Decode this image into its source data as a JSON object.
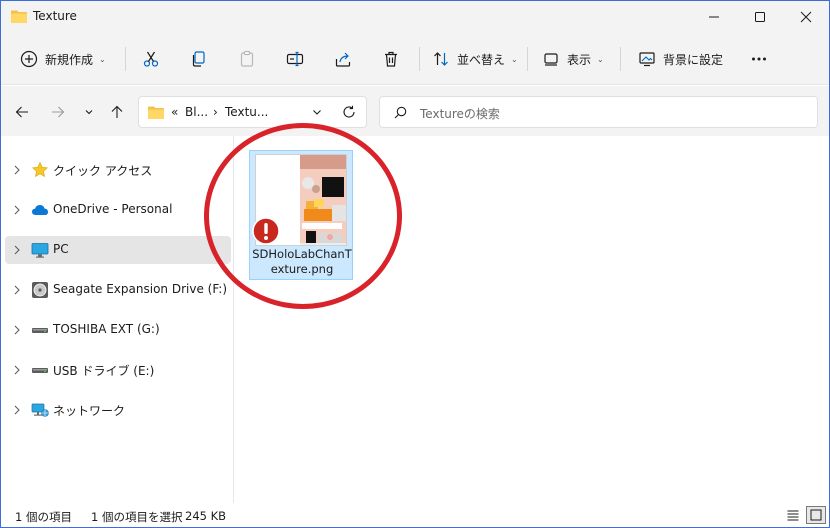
{
  "window": {
    "title": "Texture"
  },
  "toolbar": {
    "new_label": "新規作成",
    "sort_label": "並べ替え",
    "view_label": "表示",
    "set_background_label": "背景に設定"
  },
  "address": {
    "segments": [
      "«",
      "Bl...",
      "›",
      "Textu..."
    ],
    "search_placeholder": "Textureの検索"
  },
  "sidebar": {
    "items": [
      {
        "label": "クイック アクセス",
        "icon": "star-icon"
      },
      {
        "label": "OneDrive - Personal",
        "icon": "cloud-icon"
      },
      {
        "label": "PC",
        "icon": "monitor-icon",
        "selected": true
      },
      {
        "label": "Seagate Expansion Drive (F:)",
        "icon": "disk-icon"
      },
      {
        "label": "TOSHIBA EXT (G:)",
        "icon": "drive-icon"
      },
      {
        "label": "USB ドライブ (E:)",
        "icon": "drive-icon"
      },
      {
        "label": "ネットワーク",
        "icon": "network-icon"
      }
    ]
  },
  "content": {
    "file": {
      "name": "SDHoloLabChanTexture.png",
      "name_line1": "SDHoloLabChanT",
      "name_line2": "exture.png",
      "status_icon": "error-icon"
    }
  },
  "statusbar": {
    "item_count": "1 個の項目",
    "selection": "1 個の項目を選択",
    "size": "245 KB"
  },
  "colors": {
    "accent": "#0067c0",
    "selection": "#cce8ff",
    "circle": "#d9232b"
  }
}
